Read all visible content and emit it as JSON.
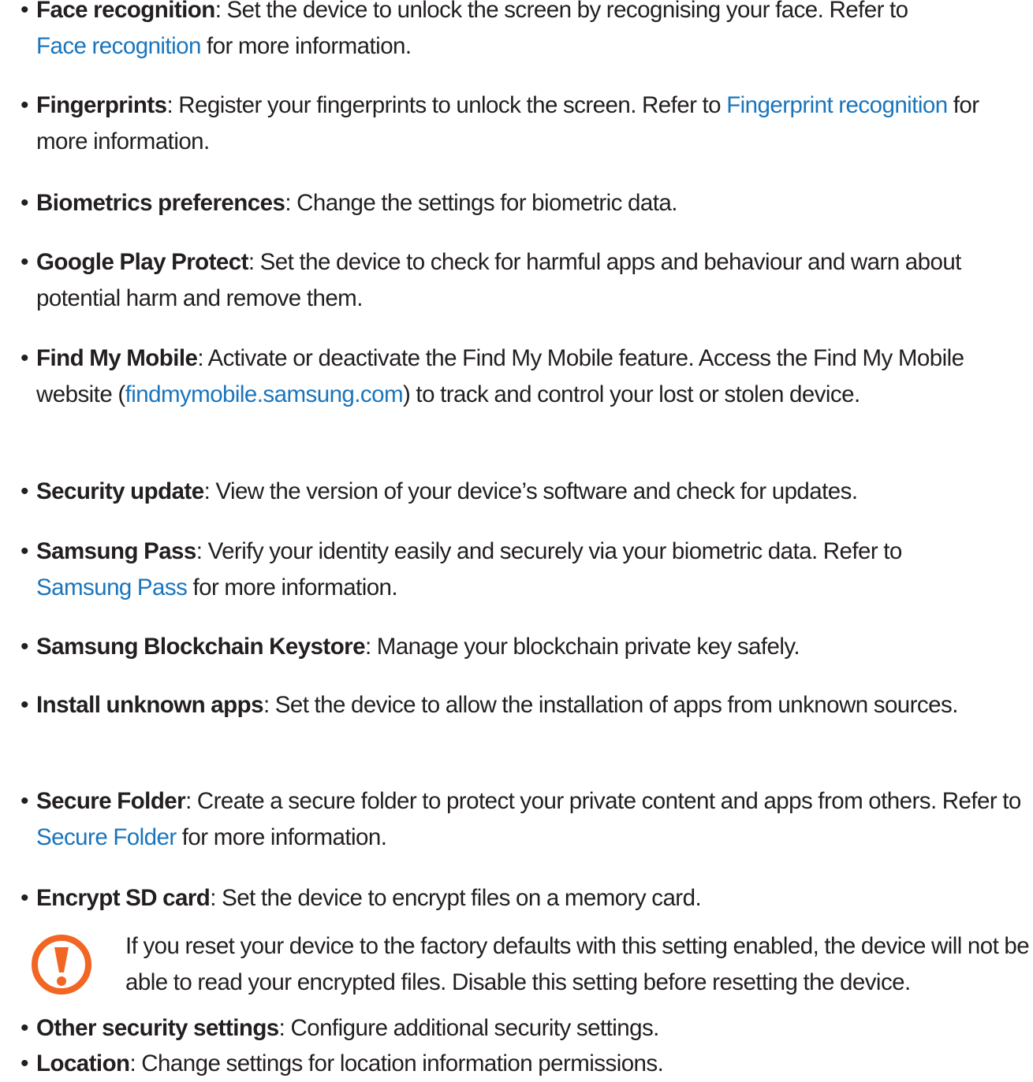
{
  "colors": {
    "text": "#231f20",
    "link": "#1a75bc",
    "caution_icon": "#f26522"
  },
  "bullet_glyph": "•",
  "items": [
    {
      "term": "Face recognition",
      "pre": ": Set the device to unlock the screen by recognising your face. Refer to ",
      "link": "Face recognition",
      "post": " for more information."
    },
    {
      "term": "Fingerprints",
      "pre": ": Register your fingerprints to unlock the screen. Refer to ",
      "link": "Fingerprint recognition",
      "post": " for more information."
    },
    {
      "term": "Biometrics preferences",
      "pre": ": Change the settings for biometric data.",
      "link": "",
      "post": ""
    },
    {
      "term": "Google Play Protect",
      "pre": ": Set the device to check for harmful apps and behaviour and warn about potential harm and remove them.",
      "link": "",
      "post": ""
    },
    {
      "term": "Find My Mobile",
      "pre": ": Activate or deactivate the Find My Mobile feature. Access the Find My Mobile website (",
      "link": "findmymobile.samsung.com",
      "post": ") to track and control your lost or stolen device."
    },
    {
      "term": "Security update",
      "pre": ": View the version of your device’s software and check for updates.",
      "link": "",
      "post": ""
    },
    {
      "term": "Samsung Pass",
      "pre": ": Verify your identity easily and securely via your biometric data. Refer to ",
      "link": "Samsung Pass",
      "post": " for more information."
    },
    {
      "term": "Samsung Blockchain Keystore",
      "pre": ": Manage your blockchain private key safely.",
      "link": "",
      "post": ""
    },
    {
      "term": "Install unknown apps",
      "pre": ": Set the device to allow the installation of apps from unknown sources.",
      "link": "",
      "post": ""
    },
    {
      "term": "Secure Folder",
      "pre": ": Create a secure folder to protect your private content and apps from others. Refer to ",
      "link": "Secure Folder",
      "post": " for more information."
    },
    {
      "term": "Encrypt SD card",
      "pre": ": Set the device to encrypt files on a memory card.",
      "link": "",
      "post": ""
    },
    {
      "term": "Other security settings",
      "pre": ": Configure additional security settings.",
      "link": "",
      "post": ""
    },
    {
      "term": "Location",
      "pre": ": Change settings for location information permissions.",
      "link": "",
      "post": ""
    }
  ],
  "caution": {
    "icon": "caution-icon",
    "text": "If you reset your device to the factory defaults with this setting enabled, the device will not be able to read your encrypted files. Disable this setting before resetting the device."
  }
}
